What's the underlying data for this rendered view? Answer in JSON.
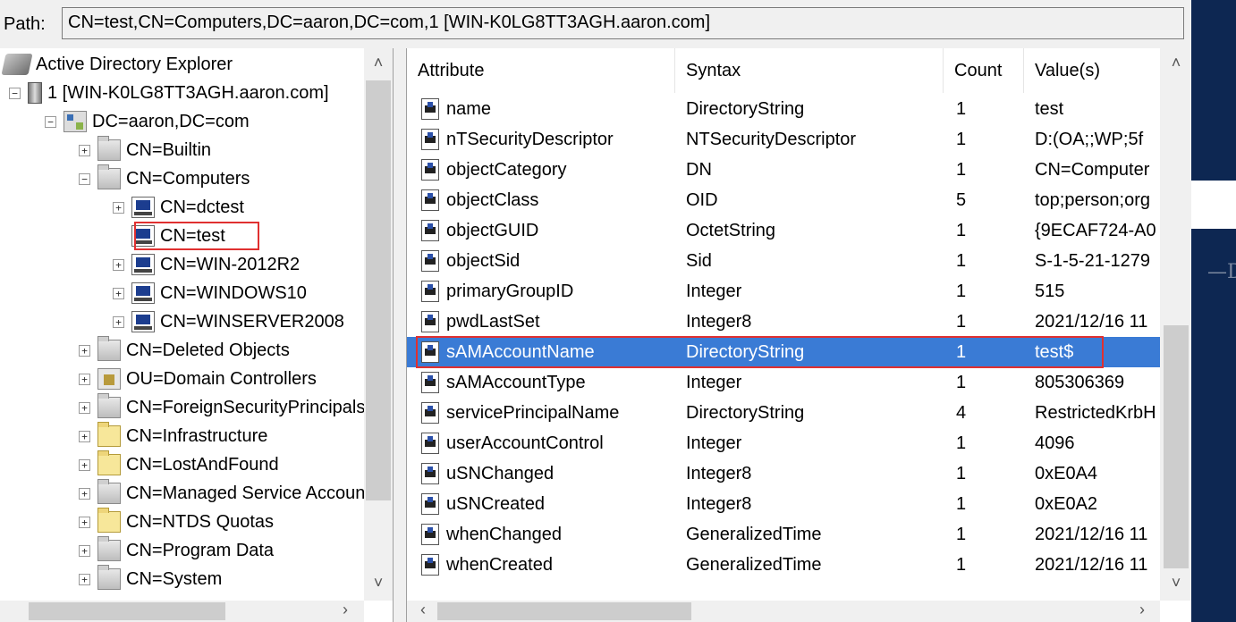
{
  "path": {
    "label": "Path:",
    "value": "CN=test,CN=Computers,DC=aaron,DC=com,1 [WIN-K0LG8TT3AGH.aaron.com]"
  },
  "tree": {
    "root": "Active Directory Explorer",
    "connection": "1 [WIN-K0LG8TT3AGH.aaron.com]",
    "domain": "DC=aaron,DC=com",
    "nodes": [
      {
        "label": "CN=Builtin",
        "icon": "folder-icon"
      },
      {
        "label": "CN=Computers",
        "icon": "folder-icon"
      },
      {
        "label": "CN=dctest",
        "icon": "computer-icon"
      },
      {
        "label": "CN=test",
        "icon": "computer-icon",
        "selected": true
      },
      {
        "label": "CN=WIN-2012R2",
        "icon": "computer-icon"
      },
      {
        "label": "CN=WINDOWS10",
        "icon": "computer-icon"
      },
      {
        "label": "CN=WINSERVER2008",
        "icon": "computer-icon"
      },
      {
        "label": "CN=Deleted Objects",
        "icon": "folder-icon"
      },
      {
        "label": "OU=Domain Controllers",
        "icon": "ou-icon"
      },
      {
        "label": "CN=ForeignSecurityPrincipals",
        "icon": "folder-icon"
      },
      {
        "label": "CN=Infrastructure",
        "icon": "yellow-folder-icon"
      },
      {
        "label": "CN=LostAndFound",
        "icon": "yellow-folder-icon"
      },
      {
        "label": "CN=Managed Service Accounts",
        "icon": "folder-icon"
      },
      {
        "label": "CN=NTDS Quotas",
        "icon": "yellow-folder-icon"
      },
      {
        "label": "CN=Program Data",
        "icon": "folder-icon"
      },
      {
        "label": "CN=System",
        "icon": "folder-icon"
      }
    ]
  },
  "list": {
    "columns": [
      "Attribute",
      "Syntax",
      "Count",
      "Value(s)"
    ],
    "rows": [
      {
        "attribute": "name",
        "syntax": "DirectoryString",
        "count": "1",
        "value": "test"
      },
      {
        "attribute": "nTSecurityDescriptor",
        "syntax": "NTSecurityDescriptor",
        "count": "1",
        "value": "D:(OA;;WP;5f"
      },
      {
        "attribute": "objectCategory",
        "syntax": "DN",
        "count": "1",
        "value": "CN=Computer"
      },
      {
        "attribute": "objectClass",
        "syntax": "OID",
        "count": "5",
        "value": "top;person;org"
      },
      {
        "attribute": "objectGUID",
        "syntax": "OctetString",
        "count": "1",
        "value": "{9ECAF724-A0"
      },
      {
        "attribute": "objectSid",
        "syntax": "Sid",
        "count": "1",
        "value": "S-1-5-21-1279"
      },
      {
        "attribute": "primaryGroupID",
        "syntax": "Integer",
        "count": "1",
        "value": "515"
      },
      {
        "attribute": "pwdLastSet",
        "syntax": "Integer8",
        "count": "1",
        "value": "2021/12/16 11"
      },
      {
        "attribute": "sAMAccountName",
        "syntax": "DirectoryString",
        "count": "1",
        "value": "test$",
        "selected": true
      },
      {
        "attribute": "sAMAccountType",
        "syntax": "Integer",
        "count": "1",
        "value": "805306369"
      },
      {
        "attribute": "servicePrincipalName",
        "syntax": "DirectoryString",
        "count": "4",
        "value": "RestrictedKrbH"
      },
      {
        "attribute": "userAccountControl",
        "syntax": "Integer",
        "count": "1",
        "value": "4096"
      },
      {
        "attribute": "uSNChanged",
        "syntax": "Integer8",
        "count": "1",
        "value": "0xE0A4"
      },
      {
        "attribute": "uSNCreated",
        "syntax": "Integer8",
        "count": "1",
        "value": "0xE0A2"
      },
      {
        "attribute": "whenChanged",
        "syntax": "GeneralizedTime",
        "count": "1",
        "value": "2021/12/16 11"
      },
      {
        "attribute": "whenCreated",
        "syntax": "GeneralizedTime",
        "count": "1",
        "value": "2021/12/16 11"
      }
    ]
  },
  "side_text": "—D",
  "colors": {
    "selection": "#3a7bd5",
    "highlight_outline": "#e03030",
    "side_panel": "#0d2752"
  }
}
